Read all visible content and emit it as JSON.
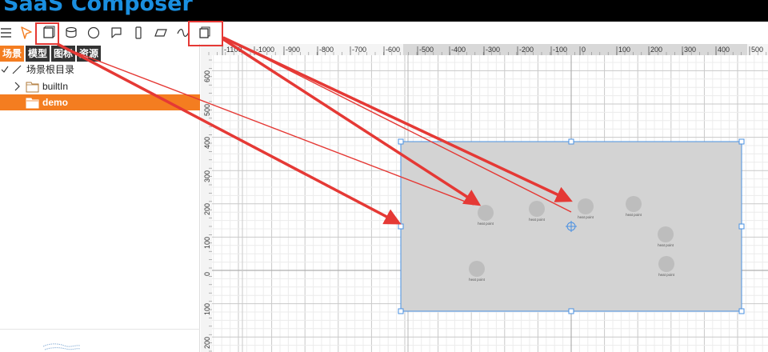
{
  "app": {
    "title": "SaaS Composer"
  },
  "toolbar": {
    "tools": [
      {
        "name": "menu-icon",
        "label": ""
      },
      {
        "name": "select-pointer-icon",
        "label": ""
      },
      {
        "name": "rectangle-icon",
        "label": ""
      },
      {
        "name": "cylinder-icon",
        "label": ""
      },
      {
        "name": "circle-icon",
        "label": ""
      },
      {
        "name": "speech-bubble-icon",
        "label": ""
      },
      {
        "name": "phone-shape-icon",
        "label": ""
      },
      {
        "name": "parallelogram-icon",
        "label": ""
      },
      {
        "name": "wave-icon",
        "label": ""
      },
      {
        "name": "copy-shape-icon",
        "label": ""
      }
    ]
  },
  "left_panel": {
    "tabs": [
      {
        "label": "场景",
        "active": true
      },
      {
        "label": "模型",
        "active": false
      },
      {
        "label": "图标",
        "active": false
      },
      {
        "label": "资源",
        "active": false
      }
    ],
    "tree": {
      "root_label": "场景根目录",
      "items": [
        {
          "label": "builtIn",
          "selected": false
        },
        {
          "label": "demo",
          "selected": true
        }
      ]
    }
  },
  "canvas": {
    "x_ticks": [
      "-1100",
      "-1000",
      "-900",
      "-800",
      "-700",
      "-600",
      "-500",
      "-400",
      "-300",
      "-200",
      "-100",
      "0",
      "100",
      "200",
      "300",
      "400",
      "500"
    ],
    "y_ticks": [
      "600",
      "500",
      "400",
      "300",
      "200",
      "100",
      "0",
      "100",
      "200"
    ],
    "heat_points": [
      {
        "label": "heat point"
      },
      {
        "label": "heat point"
      },
      {
        "label": "heat point"
      },
      {
        "label": "heat point"
      },
      {
        "label": "heat point"
      },
      {
        "label": "heat point"
      },
      {
        "label": "heat point"
      }
    ]
  },
  "colors": {
    "accent_orange": "#f47d20",
    "title_blue": "#1a8fe0",
    "annotation_red": "#e53935",
    "selection_blue": "#4a90e2",
    "shape_fill": "#d3d3d3"
  }
}
